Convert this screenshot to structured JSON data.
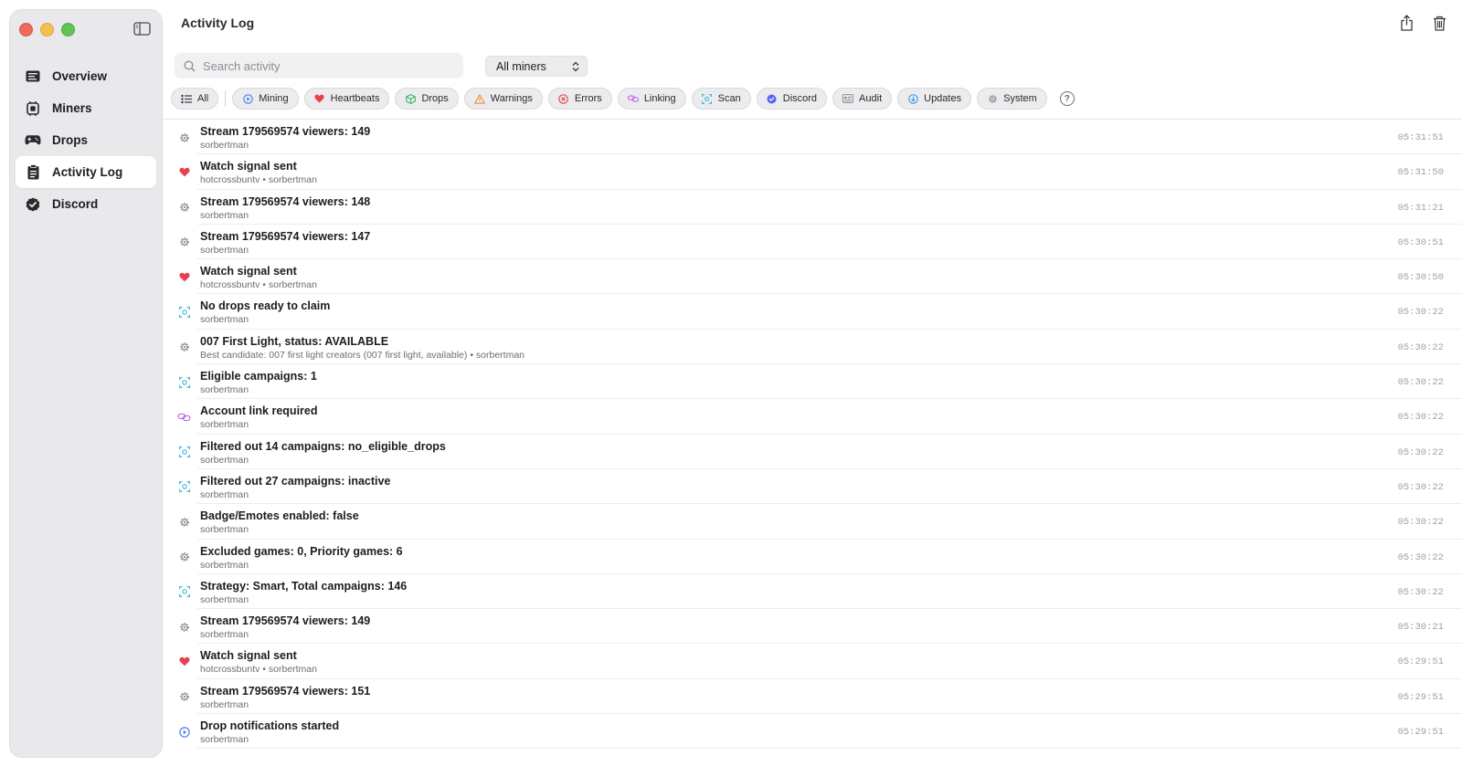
{
  "window": {
    "title": "Activity Log"
  },
  "sidebar": {
    "items": [
      {
        "label": "Overview",
        "icon": "overview-icon"
      },
      {
        "label": "Miners",
        "icon": "miners-icon"
      },
      {
        "label": "Drops",
        "icon": "gamepad-icon"
      },
      {
        "label": "Activity Log",
        "icon": "clipboard-icon",
        "active": true
      },
      {
        "label": "Discord",
        "icon": "discord-check-icon"
      }
    ]
  },
  "toolbar": {
    "search_placeholder": "Search activity",
    "miner_select_value": "All miners"
  },
  "filters": [
    {
      "label": "All",
      "icon": "list-icon",
      "color": "#3a3a3c"
    },
    {
      "label": "Mining",
      "icon": "play-circle-icon",
      "color": "#4a7cf0"
    },
    {
      "label": "Heartbeats",
      "icon": "heart-icon",
      "color": "#e8414e"
    },
    {
      "label": "Drops",
      "icon": "box-icon",
      "color": "#3fb56a"
    },
    {
      "label": "Warnings",
      "icon": "warning-icon",
      "color": "#f0932b"
    },
    {
      "label": "Errors",
      "icon": "error-icon",
      "color": "#e8414e"
    },
    {
      "label": "Linking",
      "icon": "link-icon",
      "color": "#b055e0"
    },
    {
      "label": "Scan",
      "icon": "scan-icon",
      "color": "#3bb5d8"
    },
    {
      "label": "Discord",
      "icon": "discord-icon",
      "color": "#5865f2"
    },
    {
      "label": "Audit",
      "icon": "audit-icon",
      "color": "#8a8a8f"
    },
    {
      "label": "Updates",
      "icon": "download-icon",
      "color": "#3b9be8"
    },
    {
      "label": "System",
      "icon": "gear-icon",
      "color": "#8a8a8f"
    }
  ],
  "help_label": "?",
  "entries": [
    {
      "type": "system",
      "title": "Stream 179569574 viewers: 149",
      "sub": "sorbertman",
      "time": "05:31:51"
    },
    {
      "type": "heartbeat",
      "title": "Watch signal sent",
      "sub": "hotcrossbuntv • sorbertman",
      "time": "05:31:50"
    },
    {
      "type": "system",
      "title": "Stream 179569574 viewers: 148",
      "sub": "sorbertman",
      "time": "05:31:21"
    },
    {
      "type": "system",
      "title": "Stream 179569574 viewers: 147",
      "sub": "sorbertman",
      "time": "05:30:51"
    },
    {
      "type": "heartbeat",
      "title": "Watch signal sent",
      "sub": "hotcrossbuntv • sorbertman",
      "time": "05:30:50"
    },
    {
      "type": "scan",
      "title": "No drops ready to claim",
      "sub": "sorbertman",
      "time": "05:30:22"
    },
    {
      "type": "system",
      "title": "007 First Light, status: AVAILABLE",
      "sub": "Best candidate: 007 first light creators (007 first light,  available) • sorbertman",
      "time": "05:30:22"
    },
    {
      "type": "scan",
      "title": "Eligible campaigns: 1",
      "sub": "sorbertman",
      "time": "05:30:22"
    },
    {
      "type": "linking",
      "title": "Account link required",
      "sub": "sorbertman",
      "time": "05:30:22"
    },
    {
      "type": "scan",
      "title": "Filtered out 14 campaigns: no_eligible_drops",
      "sub": "sorbertman",
      "time": "05:30:22"
    },
    {
      "type": "scan",
      "title": "Filtered out 27 campaigns: inactive",
      "sub": "sorbertman",
      "time": "05:30:22"
    },
    {
      "type": "system",
      "title": "Badge/Emotes enabled: false",
      "sub": "sorbertman",
      "time": "05:30:22"
    },
    {
      "type": "system",
      "title": "Excluded games: 0, Priority games: 6",
      "sub": "sorbertman",
      "time": "05:30:22"
    },
    {
      "type": "scan",
      "title": "Strategy: Smart, Total campaigns: 146",
      "sub": "sorbertman",
      "time": "05:30:22"
    },
    {
      "type": "system",
      "title": "Stream 179569574 viewers: 149",
      "sub": "sorbertman",
      "time": "05:30:21"
    },
    {
      "type": "heartbeat",
      "title": "Watch signal sent",
      "sub": "hotcrossbuntv • sorbertman",
      "time": "05:29:51"
    },
    {
      "type": "system",
      "title": "Stream 179569574 viewers: 151",
      "sub": "sorbertman",
      "time": "05:29:51"
    },
    {
      "type": "mining",
      "title": "Drop notifications started",
      "sub": "sorbertman",
      "time": "05:29:51"
    }
  ]
}
